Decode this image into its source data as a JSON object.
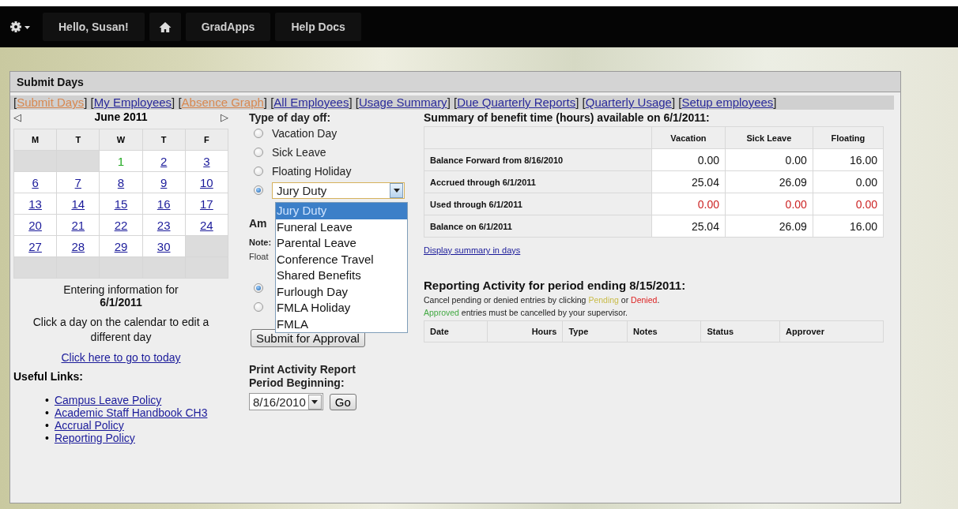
{
  "topbar": {
    "greeting": "Hello, Susan!",
    "items": [
      "GradApps",
      "Help Docs"
    ]
  },
  "panel": {
    "title": "Submit Days",
    "nav_links": [
      {
        "open": "[",
        "label": "Submit Days",
        "close": "]",
        "visited": true
      },
      {
        "open": "[",
        "label": "My Employees",
        "close": "]",
        "visited": false
      },
      {
        "open": "[",
        "label": "Absence Graph",
        "close": "]",
        "visited": true
      },
      {
        "open": "[",
        "label": "All Employees",
        "close": "]",
        "visited": false
      },
      {
        "open": "[",
        "label": "Usage Summary",
        "close": "]",
        "visited": false
      },
      {
        "open": "[",
        "label": "Due Quarterly Reports",
        "close": "]",
        "visited": false
      },
      {
        "open": "[",
        "label": "Quarterly Usage",
        "close": "]",
        "visited": false
      },
      {
        "open": "[",
        "label": "Setup employees",
        "close": "]",
        "visited": false
      }
    ]
  },
  "calendar": {
    "prev": "◁",
    "month": "June 2011",
    "next": "▷",
    "weekdays": [
      "M",
      "T",
      "W",
      "T",
      "F"
    ],
    "weeks": [
      [
        {
          "kind": "blank"
        },
        {
          "kind": "blank"
        },
        {
          "kind": "day",
          "day": "1",
          "selected": true
        },
        {
          "kind": "day",
          "day": "2",
          "selected": false
        },
        {
          "kind": "day",
          "day": "3",
          "selected": false
        }
      ],
      [
        {
          "kind": "day",
          "day": "6",
          "selected": false
        },
        {
          "kind": "day",
          "day": "7",
          "selected": false
        },
        {
          "kind": "day",
          "day": "8",
          "selected": false
        },
        {
          "kind": "day",
          "day": "9",
          "selected": false
        },
        {
          "kind": "day",
          "day": "10",
          "selected": false
        }
      ],
      [
        {
          "kind": "day",
          "day": "13",
          "selected": false
        },
        {
          "kind": "day",
          "day": "14",
          "selected": false
        },
        {
          "kind": "day",
          "day": "15",
          "selected": false
        },
        {
          "kind": "day",
          "day": "16",
          "selected": false
        },
        {
          "kind": "day",
          "day": "17",
          "selected": false
        }
      ],
      [
        {
          "kind": "day",
          "day": "20",
          "selected": false
        },
        {
          "kind": "day",
          "day": "21",
          "selected": false
        },
        {
          "kind": "day",
          "day": "22",
          "selected": false
        },
        {
          "kind": "day",
          "day": "23",
          "selected": false
        },
        {
          "kind": "day",
          "day": "24",
          "selected": false
        }
      ],
      [
        {
          "kind": "day",
          "day": "27",
          "selected": false
        },
        {
          "kind": "day",
          "day": "28",
          "selected": false
        },
        {
          "kind": "day",
          "day": "29",
          "selected": false
        },
        {
          "kind": "day",
          "day": "30",
          "selected": false
        },
        {
          "kind": "blank"
        }
      ],
      [
        {
          "kind": "blank"
        },
        {
          "kind": "blank"
        },
        {
          "kind": "blank"
        },
        {
          "kind": "blank"
        },
        {
          "kind": "blank"
        }
      ]
    ],
    "entering_label": "Entering information for",
    "entering_date": "6/1/2011",
    "hint": "Click a day on the calendar to edit a different day",
    "today_link": "Click here to go to today"
  },
  "useful_links": {
    "heading": "Useful Links:",
    "links": [
      {
        "bullet": "•",
        "label": "Campus Leave Policy"
      },
      {
        "bullet": "•",
        "label": "Academic Staff Handbook CH3"
      },
      {
        "bullet": "•",
        "label": "Accrual Policy"
      },
      {
        "bullet": "•",
        "label": "Reporting Policy"
      }
    ]
  },
  "day_type": {
    "heading": "Type of day off:",
    "options": [
      {
        "kind": "radio",
        "label": "Vacation Day",
        "selected": false
      },
      {
        "kind": "radio",
        "label": "Sick Leave",
        "selected": false
      },
      {
        "kind": "radio",
        "label": "Floating Holiday",
        "selected": false
      },
      {
        "kind": "select",
        "value": "Jury Duty",
        "selected": true,
        "expanded": true,
        "choices": [
          {
            "label": "Jury Duty",
            "selected": true
          },
          {
            "label": "Funeral Leave",
            "selected": false
          },
          {
            "label": "Parental Leave",
            "selected": false
          },
          {
            "label": "Conference Travel",
            "selected": false
          },
          {
            "label": "Shared Benefits",
            "selected": false
          },
          {
            "label": "Furlough Day",
            "selected": false
          },
          {
            "label": "FMLA Holiday",
            "selected": false
          },
          {
            "label": "FMLA",
            "selected": false
          }
        ]
      }
    ]
  },
  "amount": {
    "heading": "Am",
    "note": "Note:",
    "note_line_2": "Float",
    "radios": [
      {
        "selected": true
      },
      {
        "selected": false
      }
    ]
  },
  "submit_button": "Submit for Approval",
  "print_report": {
    "heading_lines": [
      "Print Activity Report",
      "Period Beginning:"
    ],
    "period": "8/16/2010",
    "go_button": "Go"
  },
  "summary": {
    "title": "Summary of benefit time (hours) available on 6/1/2011:",
    "columns": [
      "Vacation",
      "Sick Leave",
      "Floating"
    ],
    "rows": [
      {
        "label": "Balance Forward from 8/16/2010",
        "kind": "normal",
        "values": [
          "0.00",
          "0.00",
          "16.00"
        ]
      },
      {
        "label": "Accrued through 6/1/2011",
        "kind": "normal",
        "values": [
          "25.04",
          "26.09",
          "0.00"
        ]
      },
      {
        "label": "Used through 6/1/2011",
        "kind": "used",
        "values": [
          "0.00",
          "0.00",
          "0.00"
        ]
      },
      {
        "label": "Balance on 6/1/2011",
        "kind": "normal",
        "values": [
          "25.04",
          "26.09",
          "16.00"
        ]
      }
    ],
    "days_link": "Display summary in days"
  },
  "activity": {
    "title": "Reporting Activity for period ending 8/15/2011:",
    "notes": [
      [
        {
          "text": "Cancel pending or denied entries by clicking "
        },
        {
          "text": "Pending",
          "color": "#c9bc4a"
        },
        {
          "text": " or "
        },
        {
          "text": "Denied",
          "color": "#dd2222"
        },
        {
          "text": "."
        }
      ],
      [
        {
          "text": "Approved",
          "color": "#44aa44"
        },
        {
          "text": " entries must be cancelled by your supervisor."
        }
      ]
    ],
    "columns": [
      "Date",
      "Hours",
      "Type",
      "Notes",
      "Status",
      "Approver"
    ]
  }
}
